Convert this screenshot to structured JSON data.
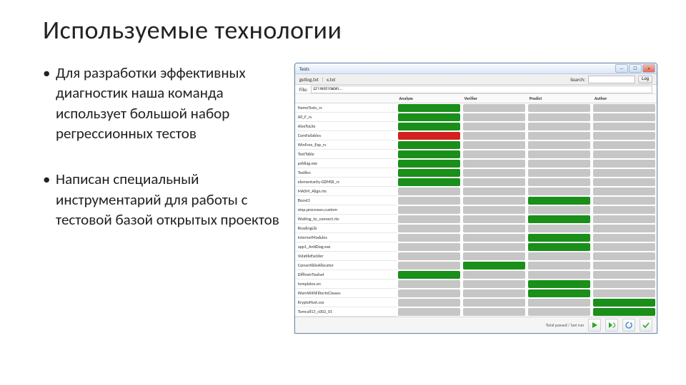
{
  "title": "Используемые технологии",
  "bullets": [
    "Для разработки эффективных диагностик наша команда использует большой набор регрессионных тестов",
    "Написан специальный инструментарий для работы с тестовой базой открытых проектов"
  ],
  "app": {
    "window_title": "Tests",
    "min_label": "—",
    "max_label": "☐",
    "close_label": "×",
    "toolbar_left_a": "getlog.txt",
    "toolbar_left_b": "x.txt",
    "search_label": "Search:",
    "search_value": "",
    "log_button": "Log",
    "path_label": "File:",
    "path_value": "D:\\TestTrace\\...",
    "columns": [
      "",
      "Analyze",
      "Verifier",
      "Predict",
      "Author"
    ],
    "footer_status": "Total passed / last run",
    "rows": [
      {
        "name": "NameTests_rs",
        "cells": [
          [
            "green",
            ""
          ],
          [
            "gray",
            ""
          ],
          [
            "gray",
            ""
          ],
          [
            "gray",
            ""
          ]
        ]
      },
      {
        "name": "All_F_rs",
        "cells": [
          [
            "green",
            ""
          ],
          [
            "gray",
            ""
          ],
          [
            "gray",
            ""
          ],
          [
            "gray",
            ""
          ]
        ]
      },
      {
        "name": "AlexToLite",
        "cells": [
          [
            "green",
            ""
          ],
          [
            "gray",
            ""
          ],
          [
            "gray",
            ""
          ],
          [
            "gray",
            ""
          ]
        ]
      },
      {
        "name": "ComFailables",
        "cells": [
          [
            "red",
            ""
          ],
          [
            "gray",
            ""
          ],
          [
            "gray",
            ""
          ],
          [
            "gray",
            ""
          ]
        ]
      },
      {
        "name": "WinFree_Exp_rs",
        "cells": [
          [
            "green",
            ""
          ],
          [
            "gray",
            ""
          ],
          [
            "gray",
            ""
          ],
          [
            "gray",
            ""
          ]
        ]
      },
      {
        "name": "TextTable",
        "cells": [
          [
            "green",
            ""
          ],
          [
            "gray",
            ""
          ],
          [
            "gray",
            ""
          ],
          [
            "gray",
            ""
          ]
        ]
      },
      {
        "name": "psfdiag.exe",
        "cells": [
          [
            "green",
            ""
          ],
          [
            "gray",
            ""
          ],
          [
            "gray",
            ""
          ],
          [
            "gray",
            ""
          ]
        ]
      },
      {
        "name": "Textiles",
        "cells": [
          [
            "green",
            ""
          ],
          [
            "gray",
            ""
          ],
          [
            "gray",
            ""
          ],
          [
            "gray",
            ""
          ]
        ]
      },
      {
        "name": "elementarity-GDMDI_rs",
        "cells": [
          [
            "green",
            ""
          ],
          [
            "gray",
            ""
          ],
          [
            "gray",
            ""
          ],
          [
            "gray",
            ""
          ]
        ]
      },
      {
        "name": "MASM_Align.rte",
        "cells": [
          [
            "gray",
            ""
          ],
          [
            "gray",
            ""
          ],
          [
            "gray",
            ""
          ],
          [
            "gray",
            ""
          ]
        ]
      },
      {
        "name": "Boost3",
        "cells": [
          [
            "gray",
            ""
          ],
          [
            "gray",
            ""
          ],
          [
            "green",
            ""
          ],
          [
            "gray",
            ""
          ]
        ]
      },
      {
        "name": "stop.processes.custom",
        "cells": [
          [
            "gray",
            ""
          ],
          [
            "gray",
            ""
          ],
          [
            "gray",
            ""
          ],
          [
            "gray",
            ""
          ]
        ]
      },
      {
        "name": "Waiting_to_connect.rte",
        "cells": [
          [
            "gray",
            ""
          ],
          [
            "gray",
            ""
          ],
          [
            "green",
            ""
          ],
          [
            "gray",
            ""
          ]
        ]
      },
      {
        "name": "ReadingLib",
        "cells": [
          [
            "gray",
            ""
          ],
          [
            "gray",
            ""
          ],
          [
            "gray",
            ""
          ],
          [
            "gray",
            ""
          ]
        ]
      },
      {
        "name": "InternetModules",
        "cells": [
          [
            "gray",
            ""
          ],
          [
            "gray",
            ""
          ],
          [
            "green",
            ""
          ],
          [
            "gray",
            ""
          ]
        ]
      },
      {
        "name": "app1_AntiDiag.exe",
        "cells": [
          [
            "gray",
            ""
          ],
          [
            "gray",
            ""
          ],
          [
            "green",
            ""
          ],
          [
            "gray",
            ""
          ]
        ]
      },
      {
        "name": "VolatileExclder",
        "cells": [
          [
            "gray",
            ""
          ],
          [
            "gray",
            ""
          ],
          [
            "gray",
            ""
          ],
          [
            "gray",
            ""
          ]
        ]
      },
      {
        "name": "ConvertibleAllocator",
        "cells": [
          [
            "gray",
            ""
          ],
          [
            "green",
            ""
          ],
          [
            "gray",
            ""
          ],
          [
            "gray",
            ""
          ]
        ]
      },
      {
        "name": "DiffInstrToolset",
        "cells": [
          [
            "green",
            ""
          ],
          [
            "gray",
            ""
          ],
          [
            "gray",
            ""
          ],
          [
            "gray",
            ""
          ]
        ]
      },
      {
        "name": "templates.src",
        "cells": [
          [
            "gray",
            ""
          ],
          [
            "gray",
            ""
          ],
          [
            "green",
            ""
          ],
          [
            "gray",
            ""
          ]
        ]
      },
      {
        "name": "WarnWithFilterInClasses",
        "cells": [
          [
            "gray",
            ""
          ],
          [
            "gray",
            ""
          ],
          [
            "green",
            ""
          ],
          [
            "gray",
            ""
          ]
        ]
      },
      {
        "name": "KryptoHost.cxx",
        "cells": [
          [
            "gray",
            ""
          ],
          [
            "gray",
            ""
          ],
          [
            "gray",
            ""
          ],
          [
            "green",
            ""
          ]
        ]
      },
      {
        "name": "Tomcall13_c002_01",
        "cells": [
          [
            "gray",
            ""
          ],
          [
            "gray",
            ""
          ],
          [
            "gray",
            ""
          ],
          [
            "green",
            ""
          ]
        ]
      }
    ]
  }
}
